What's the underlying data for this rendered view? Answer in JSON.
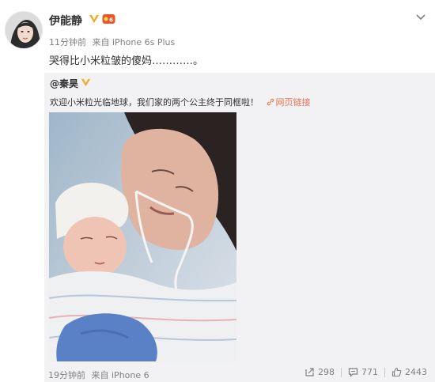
{
  "post": {
    "author": "伊能静",
    "time": "11分钟前",
    "source_prefix": "来自",
    "source": "iPhone 6s Plus",
    "text": "哭得比小米粒皱的傻妈…………。"
  },
  "repost": {
    "author": "@秦昊",
    "text": "欢迎小米粒光临地球，我们家的两个公主终于同框啦！",
    "link_label": "网页链接",
    "time": "19分钟前",
    "source_prefix": "来自",
    "source": "iPhone 6",
    "reposts": "298",
    "comments": "771",
    "likes": "2443"
  },
  "icons": {
    "verified": "verified-badge-icon",
    "vip": "vip-badge-icon",
    "menu": "chevron-down-icon",
    "link": "link-icon",
    "repost": "repost-icon",
    "comment": "comment-icon",
    "like": "thumbs-up-icon"
  },
  "colors": {
    "link": "#eb7350",
    "verified": "#f4a521",
    "vip": "#e35a2a",
    "repost_bg": "#f2f2f5"
  }
}
